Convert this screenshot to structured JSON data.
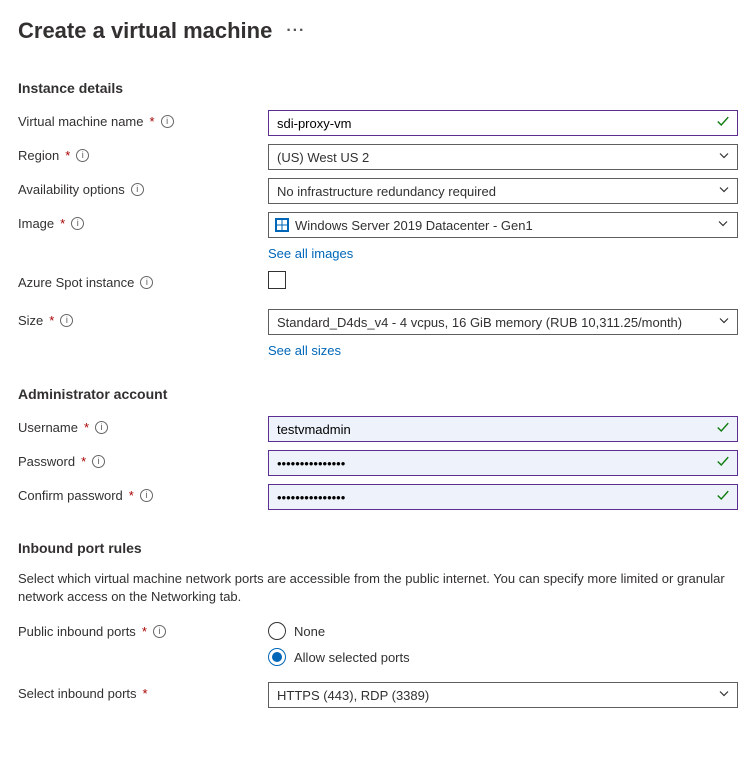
{
  "page": {
    "title": "Create a virtual machine"
  },
  "sections": {
    "instance": {
      "heading": "Instance details"
    },
    "admin": {
      "heading": "Administrator account"
    },
    "ports": {
      "heading": "Inbound port rules",
      "description": "Select which virtual machine network ports are accessible from the public internet. You can specify more limited or granular network access on the Networking tab."
    }
  },
  "labels": {
    "vm_name": "Virtual machine name",
    "region": "Region",
    "availability": "Availability options",
    "image": "Image",
    "spot": "Azure Spot instance",
    "size": "Size",
    "username": "Username",
    "password": "Password",
    "confirm": "Confirm password",
    "public_ports": "Public inbound ports",
    "select_ports": "Select inbound ports"
  },
  "values": {
    "vm_name": "sdi-proxy-vm",
    "region": "(US) West US 2",
    "availability": "No infrastructure redundancy required",
    "image": "Windows Server 2019 Datacenter - Gen1",
    "size": "Standard_D4ds_v4 - 4 vcpus, 16 GiB memory (RUB 10,311.25/month)",
    "username": "testvmadmin",
    "password": "•••••••••••••••",
    "confirm": "•••••••••••••••",
    "select_ports": "HTTPS (443), RDP (3389)"
  },
  "links": {
    "all_images": "See all images",
    "all_sizes": "See all sizes"
  },
  "radios": {
    "none": "None",
    "allow": "Allow selected ports"
  }
}
